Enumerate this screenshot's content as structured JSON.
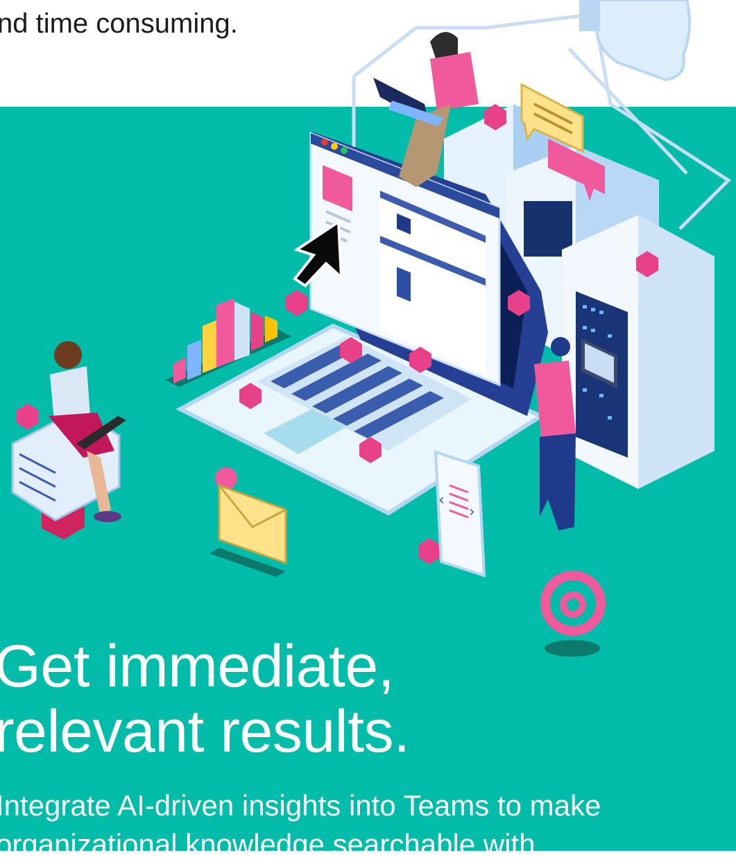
{
  "intro": {
    "line_cut": "nd time consuming.",
    "line_above": ""
  },
  "headline": {
    "line1": "Get immediate,",
    "line2": "relevant results."
  },
  "body": {
    "line1": "Integrate AI-driven insights into Teams to make",
    "line2": "organizational knowledge searchable with"
  },
  "colors": {
    "teal": "#00bca9",
    "pink": "#e8418a",
    "navy": "#1f3a8a",
    "light_blue": "#dceefc"
  },
  "illustration": {
    "icon": "isometric-tech-workspace-illustration"
  }
}
